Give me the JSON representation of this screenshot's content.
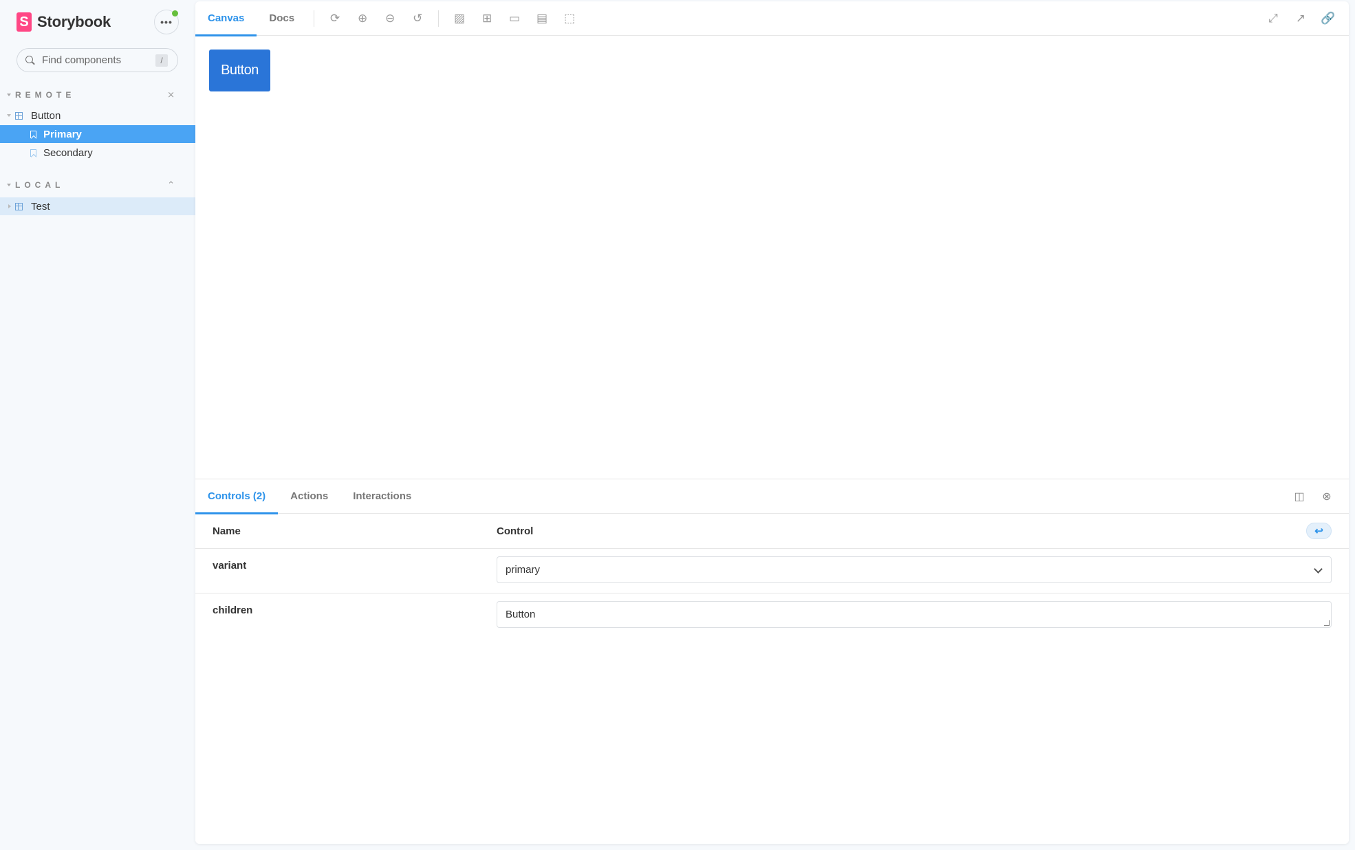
{
  "sidebar": {
    "brand": "Storybook",
    "brand_letter": "S",
    "menu_label": "•••",
    "search": {
      "placeholder": "Find components",
      "value": "",
      "shortcut": "/"
    },
    "sections": [
      {
        "title": "REMOTE",
        "toggle_icon": "collapse-all-icon",
        "toggle_glyph": "⨯",
        "items": [
          {
            "type": "component",
            "label": "Button",
            "expanded": true,
            "stories": [
              {
                "label": "Primary",
                "selected": true
              },
              {
                "label": "Secondary",
                "selected": false
              }
            ]
          }
        ]
      },
      {
        "title": "LOCAL",
        "toggle_icon": "expand-all-icon",
        "toggle_glyph": "⌃",
        "items": [
          {
            "type": "component",
            "label": "Test",
            "expanded": false,
            "highlighted": true
          }
        ]
      }
    ]
  },
  "toolbar": {
    "tabs": [
      {
        "label": "Canvas",
        "active": true
      },
      {
        "label": "Docs",
        "active": false
      }
    ],
    "tools": [
      {
        "name": "reload-icon",
        "glyph": "⟳"
      },
      {
        "name": "zoom-in-icon",
        "glyph": "⊕"
      },
      {
        "name": "zoom-out-icon",
        "glyph": "⊖"
      },
      {
        "name": "zoom-reset-icon",
        "glyph": "↺"
      },
      {
        "name": "background-icon",
        "glyph": "▨"
      },
      {
        "name": "grid-icon",
        "glyph": "⊞"
      },
      {
        "name": "viewport-icon",
        "glyph": "▭"
      },
      {
        "name": "measure-icon",
        "glyph": "▤"
      },
      {
        "name": "outline-icon",
        "glyph": "⬚"
      }
    ],
    "right_tools": [
      {
        "name": "fullscreen-icon",
        "glyph": "⤢"
      },
      {
        "name": "open-new-tab-icon",
        "glyph": "↗"
      },
      {
        "name": "copy-link-icon",
        "glyph": "🔗"
      }
    ]
  },
  "canvas": {
    "button_label": "Button",
    "button_color": "#2a75d8"
  },
  "addons": {
    "tabs": [
      {
        "label": "Controls (2)",
        "active": true
      },
      {
        "label": "Actions",
        "active": false
      },
      {
        "label": "Interactions",
        "active": false
      }
    ],
    "actions": [
      {
        "name": "panel-orientation-icon",
        "glyph": "◫"
      },
      {
        "name": "close-panel-icon",
        "glyph": "⊗"
      }
    ],
    "table": {
      "headers": {
        "name": "Name",
        "control": "Control"
      },
      "reset_glyph": "↩",
      "rows": [
        {
          "name": "variant",
          "control_type": "select",
          "value": "primary"
        },
        {
          "name": "children",
          "control_type": "text",
          "value": "Button"
        }
      ]
    }
  },
  "colors": {
    "accent": "#2e93ea",
    "selected_bg": "#4aa4f4",
    "brand": "#ff4785",
    "status_dot": "#66bf3c"
  }
}
